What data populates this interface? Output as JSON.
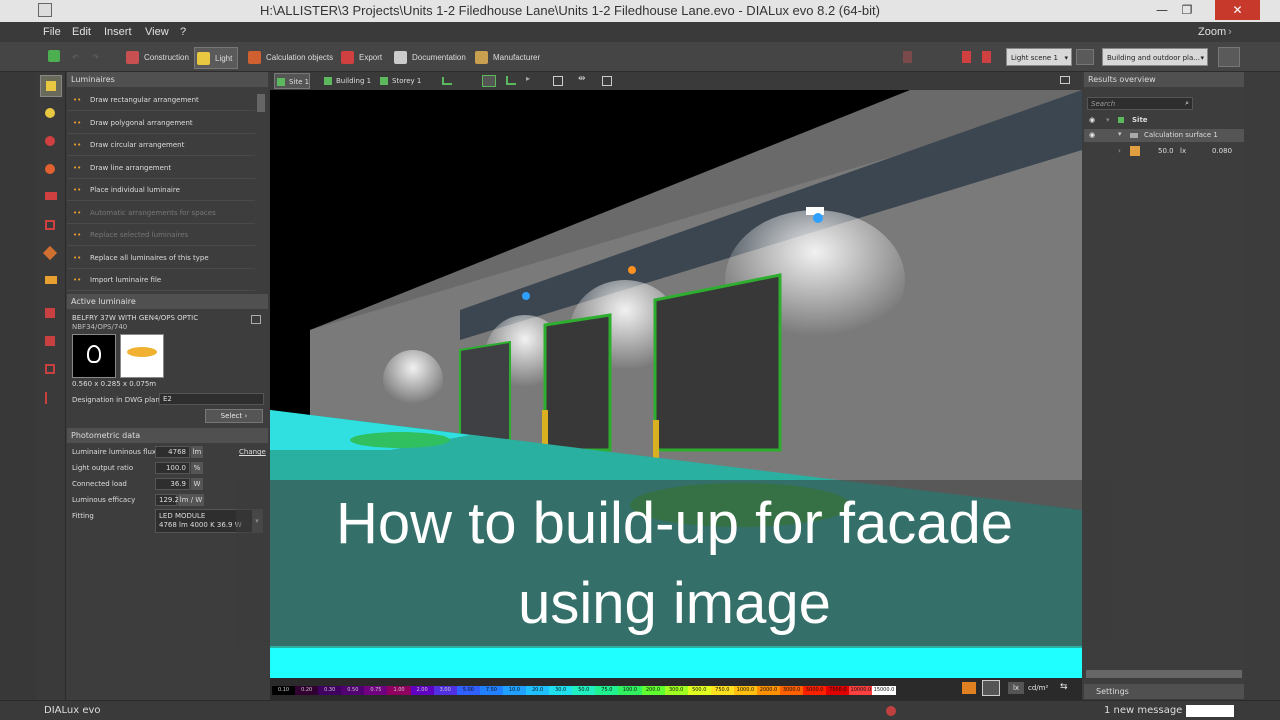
{
  "window": {
    "title": "H:\\ALLISTER\\3 Projects\\Units 1-2 Filedhouse Lane\\Units 1-2 Filedhouse Lane.evo - DIALux evo 8.2  (64-bit)",
    "minimize": "—",
    "maximize": "❐",
    "close": "✕"
  },
  "menu": {
    "file": "File",
    "edit": "Edit",
    "insert": "Insert",
    "view": "View",
    "help": "?",
    "zoom": "Zoom"
  },
  "toolbar": {
    "construction": "Construction",
    "light": "Light",
    "calculation_objects": "Calculation objects",
    "export": "Export",
    "documentation": "Documentation",
    "manufacturer": "Manufacturer",
    "light_scene": "Light scene 1",
    "view_mode": "Building and outdoor pla..."
  },
  "luminaires_panel": {
    "header": "Luminaires",
    "items": [
      {
        "label": "Draw rectangular arrangement",
        "enabled": true
      },
      {
        "label": "Draw polygonal arrangement",
        "enabled": true
      },
      {
        "label": "Draw circular arrangement",
        "enabled": true
      },
      {
        "label": "Draw line arrangement",
        "enabled": true
      },
      {
        "label": "Place individual luminaire",
        "enabled": true
      },
      {
        "label": "Automatic arrangements for spaces",
        "enabled": false
      },
      {
        "label": "Replace selected luminaires",
        "enabled": false
      },
      {
        "label": "Replace all luminaires of this type",
        "enabled": true
      },
      {
        "label": "Import luminaire file",
        "enabled": true
      }
    ]
  },
  "active_luminaire": {
    "header": "Active luminaire",
    "name": "BELFRY 37W WITH GEN4/OPS OPTIC",
    "code": "NBF34/OPS/740",
    "dimensions": "0.560 x 0.285 x 0.075m",
    "designation_label": "Designation in DWG plan",
    "designation_value": "E2",
    "select_button": "Select"
  },
  "photometric": {
    "header": "Photometric data",
    "flux_label": "Luminaire luminous flux",
    "flux_value": "4768",
    "flux_unit": "lm",
    "change": "Change",
    "lor_label": "Light output ratio",
    "lor_value": "100.0",
    "lor_unit": "%",
    "load_label": "Connected load",
    "load_value": "36.9",
    "load_unit": "W",
    "efficacy_label": "Luminous efficacy",
    "efficacy_value": "129.2",
    "efficacy_unit": "lm / W",
    "fitting_label": "Fitting",
    "fitting_line1": "LED MODULE",
    "fitting_line2": "4768 lm   4000 K   36.9 W"
  },
  "viewport_tabs": {
    "site": "Site 1",
    "building": "Building 1",
    "storey": "Storey 1"
  },
  "results": {
    "header": "Results overview",
    "search_placeholder": "Search",
    "site": "Site",
    "surface": "Calculation surface 1",
    "value": "50.0",
    "unit": "lx",
    "ratio": "0.080",
    "settings": "Settings"
  },
  "colorbar": {
    "values": [
      "0.10",
      "0.20",
      "0.30",
      "0.50",
      "0.75",
      "1.00",
      "2.00",
      "3.00",
      "5.00",
      "7.50",
      "10.0",
      "20.0",
      "30.0",
      "50.0",
      "75.0",
      "100.0",
      "200.0",
      "300.0",
      "500.0",
      "750.0",
      "1000.0",
      "2000.0",
      "3000.0",
      "5000.0",
      "7500.0",
      "10000.0",
      "15000.0"
    ],
    "colors": [
      "#000000",
      "#300030",
      "#400060",
      "#500070",
      "#700080",
      "#900060",
      "#6000c0",
      "#5030e0",
      "#3060ff",
      "#2080ff",
      "#20a0ff",
      "#20c0ff",
      "#20e0f0",
      "#20f0c0",
      "#20f090",
      "#30f060",
      "#60ff30",
      "#a0ff20",
      "#e0ff20",
      "#ffe020",
      "#ffc010",
      "#ff9000",
      "#ff6000",
      "#ff2000",
      "#e00000",
      "#ff4040",
      "#ffffff"
    ],
    "unit_lx": "lx",
    "unit_cd": "cd/m²"
  },
  "status": {
    "brand": "DIALux evo",
    "message": "1 new message"
  },
  "caption": {
    "line1": "How to build-up for facade",
    "line2": "using image"
  }
}
